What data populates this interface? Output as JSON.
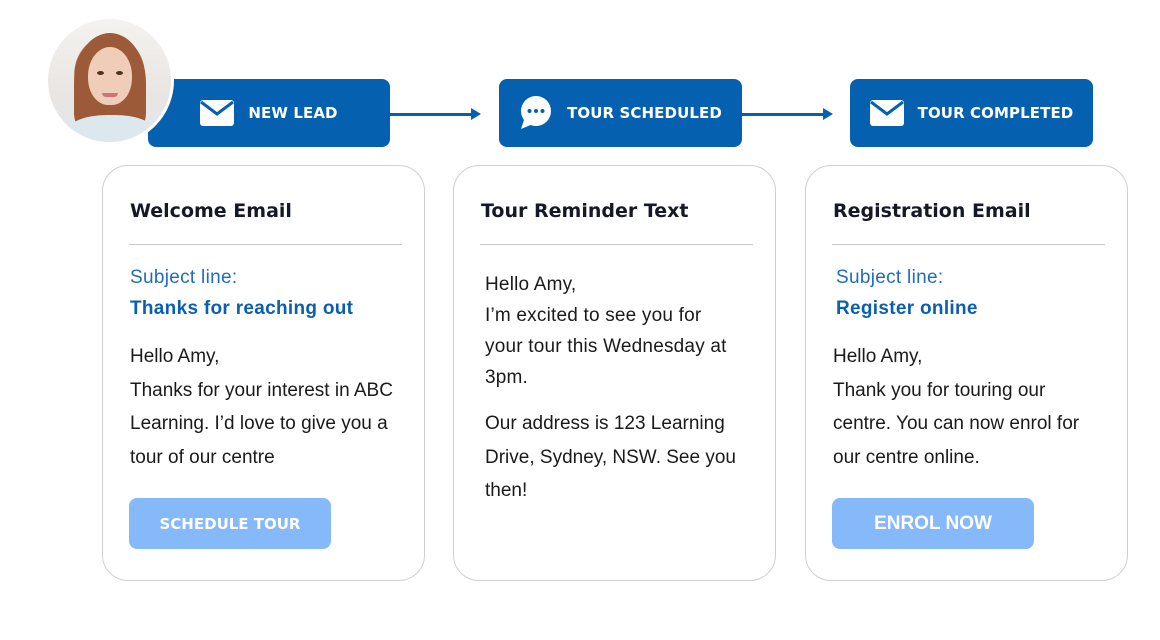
{
  "avatar": {
    "description": "Amy profile photo"
  },
  "stages": [
    {
      "label": "NEW LEAD",
      "icon": "envelope-icon"
    },
    {
      "label": "TOUR SCHEDULED",
      "icon": "chat-bubble-icon"
    },
    {
      "label": "TOUR COMPLETED",
      "icon": "envelope-icon"
    }
  ],
  "cards": [
    {
      "title": "Welcome Email",
      "subject_label": "Subject line:",
      "subject": "Thanks for reaching out",
      "body": [
        "Hello Amy,",
        "Thanks for your interest in ABC",
        "Learning. I’d love to give you a",
        "tour of our centre"
      ],
      "button": "SCHEDULE TOUR"
    },
    {
      "title": "Tour Reminder Text",
      "body": [
        "Hello Amy,",
        "I’m excited to see you for",
        "your tour this Wednesday at",
        "3pm."
      ],
      "body2": [
        "Our address is 123 Learning",
        "Drive, Sydney, NSW. See you",
        "then!"
      ]
    },
    {
      "title": "Registration Email",
      "subject_label": "Subject line:",
      "subject": "Register online",
      "body": [
        "Hello Amy,",
        "Thank you for touring our",
        "centre. You can now enrol for",
        "our centre online."
      ],
      "button": "ENROL NOW"
    }
  ],
  "colors": {
    "primary": "#0560b0",
    "button": "#85b9fa",
    "subject": "#0a5fae",
    "title": "#151826"
  }
}
